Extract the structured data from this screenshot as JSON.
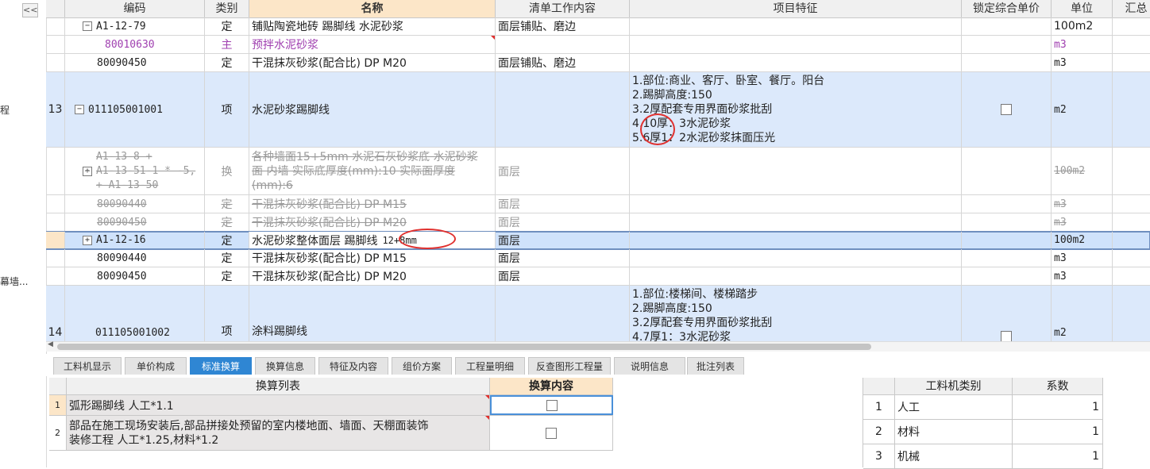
{
  "left_panel": {
    "collapse_label": "<<",
    "item1": "程",
    "item2": "幕墙..."
  },
  "columns": {
    "code": "编码",
    "type": "类别",
    "name": "名称",
    "work": "清单工作内容",
    "feature": "项目特征",
    "lock": "锁定综合单价",
    "unit": "单位",
    "sum": "汇总"
  },
  "rows": [
    {
      "num": "",
      "code": "A1-12-79",
      "tree": "−",
      "type": "定",
      "name": "铺贴陶瓷地砖 踢脚线 水泥砂浆",
      "work": "面层铺贴、磨边",
      "unit": "100m2"
    },
    {
      "num": "",
      "code": "80010630",
      "tree": "",
      "type": "主",
      "name": "预拌水泥砂浆",
      "work": "",
      "unit": "m3"
    },
    {
      "num": "",
      "code": "80090450",
      "tree": "",
      "type": "定",
      "name": "干混抹灰砂浆(配合比) DP M20",
      "work": "面层铺贴、磨边",
      "unit": "m3"
    },
    {
      "num": "13",
      "code": "011105001001",
      "tree": "−",
      "type": "项",
      "name": "水泥砂浆踢脚线",
      "work": "",
      "unit": "m2",
      "features": [
        "1.部位:商业、客厅、卧室、餐厅。阳台",
        "2.踢脚高度:150",
        "3.2厚配套专用界面砂浆批刮",
        "4.10厚：3水泥砂浆",
        "5.6厚1：2水泥砂浆抹面压光"
      ]
    },
    {
      "num": "",
      "code_lines": [
        "A1-13-8 +",
        "A1-13-51-1 * -5,",
        "+ A1-13-50"
      ],
      "tree": "+",
      "type": "换",
      "name_lines": [
        "各种墙面15+5mm 水泥石灰砂浆底 水泥砂浆",
        "面 内墙  实际底厚度(mm):10  实际面厚度",
        "(mm):6"
      ],
      "work": "面层",
      "unit": "100m2"
    },
    {
      "num": "",
      "code": "80090440",
      "tree": "",
      "type": "定",
      "name": "干混抹灰砂浆(配合比) DP M15",
      "work": "面层",
      "unit": "m3"
    },
    {
      "num": "",
      "code": "80090450",
      "tree": "",
      "type": "定",
      "name": "干混抹灰砂浆(配合比) DP M20",
      "work": "面层",
      "unit": "m3"
    },
    {
      "num": "",
      "code": "A1-12-16",
      "tree": "+",
      "type": "定",
      "name": "水泥砂浆整体面层 踢脚线",
      "name_note": "12+8mm",
      "work": "面层",
      "unit": "100m2"
    },
    {
      "num": "",
      "code": "80090440",
      "tree": "",
      "type": "定",
      "name": "干混抹灰砂浆(配合比) DP M15",
      "work": "面层",
      "unit": "m3"
    },
    {
      "num": "",
      "code": "80090450",
      "tree": "",
      "type": "定",
      "name": "干混抹灰砂浆(配合比) DP M20",
      "work": "面层",
      "unit": "m3"
    },
    {
      "num": "14",
      "code": "011105001002",
      "tree": "",
      "type": "项",
      "name": "涂料踢脚线",
      "work": "",
      "unit": "m2",
      "features": [
        "1.部位:楼梯间、楼梯踏步",
        "2.踢脚高度:150",
        "3.2厚配套专用界面砂浆批刮",
        "4.7厚1：3水泥砂浆"
      ]
    }
  ],
  "tabs": [
    "工料机显示",
    "单价构成",
    "标准换算",
    "换算信息",
    "特征及内容",
    "组价方案",
    "工程量明细",
    "反查图形工程量",
    "说明信息",
    "批注列表"
  ],
  "active_tab": "标准换算",
  "conversion": {
    "col_list": "换算列表",
    "col_content": "换算内容",
    "rows": [
      {
        "num": "1",
        "text": "弧形踢脚线 人工*1.1"
      },
      {
        "num": "2",
        "text_lines": [
          "部品在施工现场安装后,部品拼接处预留的室内楼地面、墙面、天棚面装饰",
          "装修工程 人工*1.25,材料*1.2"
        ]
      }
    ]
  },
  "coef": {
    "col_type": "工料机类别",
    "col_coef": "系数",
    "rows": [
      {
        "num": "1",
        "type": "人工",
        "coef": "1"
      },
      {
        "num": "2",
        "type": "材料",
        "coef": "1"
      },
      {
        "num": "3",
        "type": "机械",
        "coef": "1"
      }
    ]
  },
  "colors": {
    "accent": "#2f86d3",
    "row_blue": "#dce9fb",
    "header_highlight": "#fce6c8",
    "annotation": "#e0302e",
    "purple": "#a040b0"
  }
}
